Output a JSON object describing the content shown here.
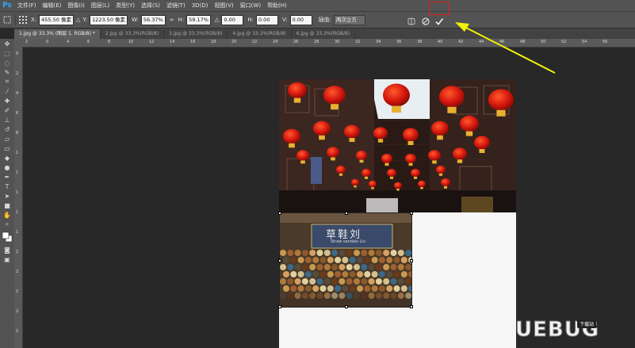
{
  "app": {
    "logo": "Ps"
  },
  "menu": [
    "文件(F)",
    "编辑(E)",
    "图像(I)",
    "图层(L)",
    "类型(Y)",
    "选择(S)",
    "滤镜(T)",
    "3D(D)",
    "视图(V)",
    "窗口(W)",
    "帮助(H)"
  ],
  "options": {
    "x_label": "X:",
    "x_value": "455.50 像素",
    "y_label": "Y:",
    "y_value": "1223.50 像素",
    "w_label": "W:",
    "w_value": "56.37%",
    "h_label": "H:",
    "h_value": "59.17%",
    "angle_value": "0.00",
    "hskew_label": "H:",
    "hskew_value": "0.00",
    "vskew_label": "V:",
    "vskew_value": "0.00",
    "interp_label": "插值:",
    "interp_value": "两次立方",
    "commit_icon": "checkmark-icon",
    "cancel_icon": "cancel-icon",
    "warp_icon": "warp-icon"
  },
  "tabs": [
    {
      "label": "1.jpg @ 33.3% (图层 1, RGB/8) *",
      "active": true
    },
    {
      "label": "2.jpg @ 33.3%(RGB/8)",
      "active": false
    },
    {
      "label": "3.jpg @ 33.3%(RGB/8)",
      "active": false
    },
    {
      "label": "4.jpg @ 33.3%(RGB/8)",
      "active": false
    },
    {
      "label": "6.jpg @ 33.3%(RGB/8)",
      "active": false
    }
  ],
  "ruler": {
    "top": [
      "2",
      "0",
      "4",
      "6",
      "8",
      "10",
      "12",
      "14",
      "16",
      "18",
      "20",
      "22",
      "24",
      "26",
      "28",
      "30",
      "32",
      "34",
      "36",
      "38",
      "40",
      "42",
      "44",
      "46",
      "48",
      "50",
      "52",
      "54",
      "56"
    ],
    "left": [
      "0",
      "2",
      "4",
      "6",
      "8",
      "1",
      "1",
      "1",
      "1",
      "1",
      "2",
      "2",
      "2",
      "2",
      "2"
    ]
  },
  "image_sign": {
    "title": "草鞋刘",
    "subtitle": "Straw sandals Liu"
  },
  "watermark": {
    "text": "UEBUG",
    "badge": "下载站"
  },
  "colors": {
    "accent_red": "#e0201a",
    "arrow_yellow": "#f2f20a",
    "ps_blue": "#31a8ff"
  }
}
